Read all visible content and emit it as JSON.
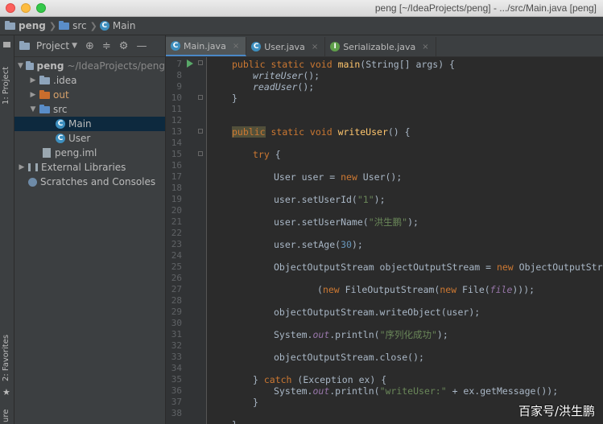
{
  "window": {
    "title": "peng [~/IdeaProjects/peng] - .../src/Main.java [peng]"
  },
  "breadcrumb": [
    "peng",
    "src",
    "Main"
  ],
  "left_strip": {
    "project_tab": "1: Project",
    "favorites_tab": "2: Favorites",
    "bottom_fragment": "ure"
  },
  "project_panel": {
    "title": "Project",
    "tree": [
      {
        "label": "peng",
        "path": "~/IdeaProjects/peng"
      },
      {
        "label": ".idea"
      },
      {
        "label": "out"
      },
      {
        "label": "src"
      },
      {
        "label": "Main"
      },
      {
        "label": "User"
      },
      {
        "label": "peng.iml"
      },
      {
        "label": "External Libraries"
      },
      {
        "label": "Scratches and Consoles"
      }
    ]
  },
  "tabs": [
    {
      "label": "Main.java",
      "active": true
    },
    {
      "label": "User.java",
      "active": false
    },
    {
      "label": "Serializable.java",
      "active": false
    }
  ],
  "line_numbers": [
    "7",
    "8",
    "9",
    "10",
    "11",
    "12",
    "13",
    "14",
    "15",
    "16",
    "17",
    "18",
    "19",
    "20",
    "21",
    "22",
    "23",
    "24",
    "25",
    "26",
    "27",
    "28",
    "29",
    "30",
    "31",
    "32",
    "33",
    "34",
    "35",
    "36",
    "37",
    "38"
  ],
  "code": {
    "l7_a": "public static void ",
    "l7_fn": "main",
    "l7_b": "(String[] args) {",
    "l8": "writeUser",
    "l8_tail": "();",
    "l9": "readUser",
    "l9_tail": "();",
    "l10": "}",
    "l13_kw": "public",
    "l13_a": " static void ",
    "l13_fn": "writeUser",
    "l13_b": "() {",
    "l15_kw": "try",
    "l15_b": " {",
    "l17_a": "User user = ",
    "l17_kw": "new",
    "l17_b": " User();",
    "l19_a": "user.setUserId(",
    "l19_str": "\"1\"",
    "l19_b": ");",
    "l21_a": "user.setUserName(",
    "l21_str": "\"洪生鹏\"",
    "l21_b": ");",
    "l23_a": "user.setAge(",
    "l23_num": "30",
    "l23_b": ");",
    "l25_a": "ObjectOutputStream objectOutputStream = ",
    "l25_kw": "new",
    "l25_b": " ObjectOutputStream",
    "l27_a": "(",
    "l27_kw1": "new",
    "l27_b": " FileOutputStream(",
    "l27_kw2": "new",
    "l27_c": " File(",
    "l27_it": "file",
    "l27_d": ")));",
    "l29": "objectOutputStream.writeObject(user);",
    "l31_a": "System.",
    "l31_it": "out",
    "l31_b": ".println(",
    "l31_str": "\"序列化成功\"",
    "l31_c": ");",
    "l33": "objectOutputStream.close();",
    "l35_a": "} ",
    "l35_kw": "catch",
    "l35_b": " (Exception ex) {",
    "l36_a": "System.",
    "l36_it": "out",
    "l36_b": ".println(",
    "l36_str": "\"writeUser:\"",
    "l36_c": " + ex.getMessage());",
    "l37": "}",
    "l39": "}"
  },
  "watermark": "百家号/洪生鹏",
  "colors": {
    "accent": "#4a88c7",
    "keyword": "#cc7832",
    "method": "#ffc66d",
    "string": "#6a8759",
    "number": "#6897bb"
  }
}
